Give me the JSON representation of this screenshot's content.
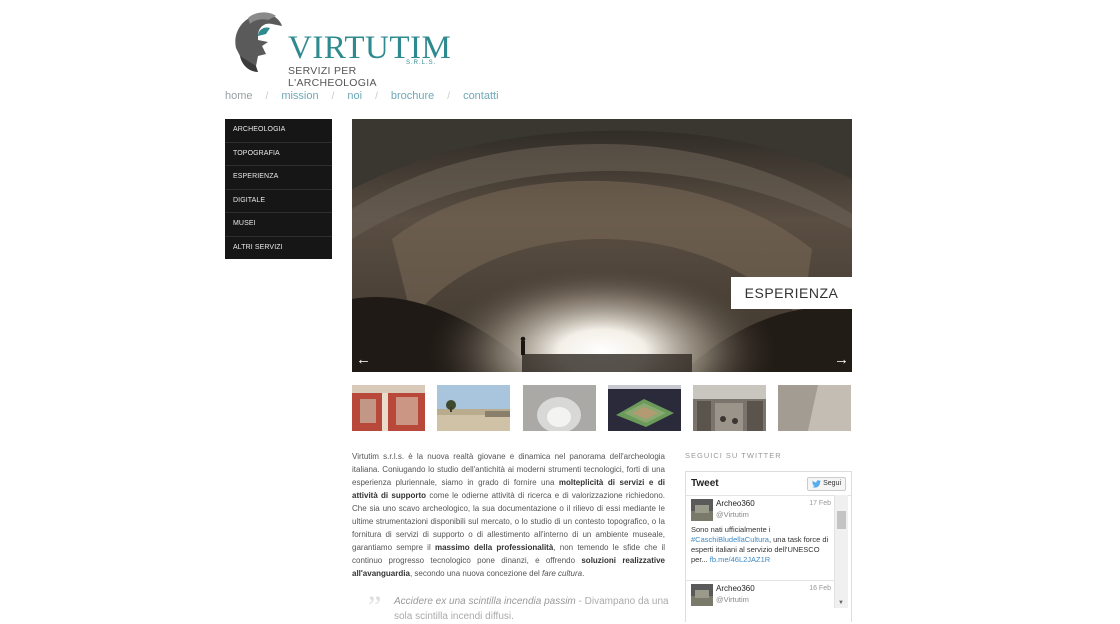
{
  "logo": {
    "brand": "VIRTUTIM",
    "suffix": "S.R.L.S.",
    "tagline": "SERVIZI PER L'ARCHEOLOGIA"
  },
  "nav": [
    "home",
    "mission",
    "noi",
    "brochure",
    "contatti"
  ],
  "nav_separator": "/",
  "side_menu": [
    "ARCHEOLOGIA",
    "TOPOGRAFIA",
    "ESPERIENZA",
    "DIGITALE",
    "MUSEI",
    "ALTRI SERVIZI"
  ],
  "slider": {
    "caption": "ESPERIENZA",
    "prev": "←",
    "next": "→"
  },
  "intro": {
    "p1": "Virtutim s.r.l.s. è la nuova realtà giovane e dinamica nel panorama dell'archeologia italiana. Coniugando lo studio dell'antichità ai moderni strumenti tecnologici, forti di una esperienza pluriennale, siamo in grado di fornire una ",
    "b1": "molteplicità di servizi e di attività di supporto",
    "p2": " come le odierne attività di ricerca e di valorizzazione richiedono. Che sia uno scavo archeologico, la sua documentazione o il rilievo di essi mediante le ultime strumentazioni disponibili sul mercato, o lo studio di un contesto topografico, o la fornitura di servizi di supporto o di allestimento all'interno di un ambiente museale, garantiamo sempre il ",
    "b2": "massimo della professionalità",
    "p3": ", non temendo le sfide che il continuo progresso tecnologico pone dinanzi, e offrendo ",
    "b3": "soluzioni realizzative all'avanguardia",
    "p4": ", secondo una nuova concezione del ",
    "i1": "fare cultura",
    "p5": "."
  },
  "quote": {
    "mark": "”",
    "latin": "Accidere ex una scintilla incendia passim",
    "rest": " - Divampano da una sola scintilla incendi diffusi."
  },
  "twitter": {
    "section_title": "SEGUICI SU TWITTER",
    "header": "Tweet",
    "follow": "Segui",
    "tweets": [
      {
        "name": "Archeo360",
        "handle": "@Virtutim",
        "date": "17 Feb",
        "text_a": "Sono nati ufficialmente i ",
        "link_a": "#CaschiBludellaCultura",
        "text_b": ", una task force di esperti italiani al servizio dell'UNESCO per... ",
        "link_b": "fb.me/46L2JAZ1R"
      },
      {
        "name": "Archeo360",
        "handle": "@Virtutim",
        "date": "16 Feb",
        "text_a": "",
        "link_a": "",
        "text_b": "",
        "link_b": ""
      }
    ]
  },
  "colors": {
    "brand_teal": "#2f8a8f",
    "nav_link": "#6fa8b8",
    "menu_bg": "#161616",
    "twitter_link": "#3b88c3"
  }
}
